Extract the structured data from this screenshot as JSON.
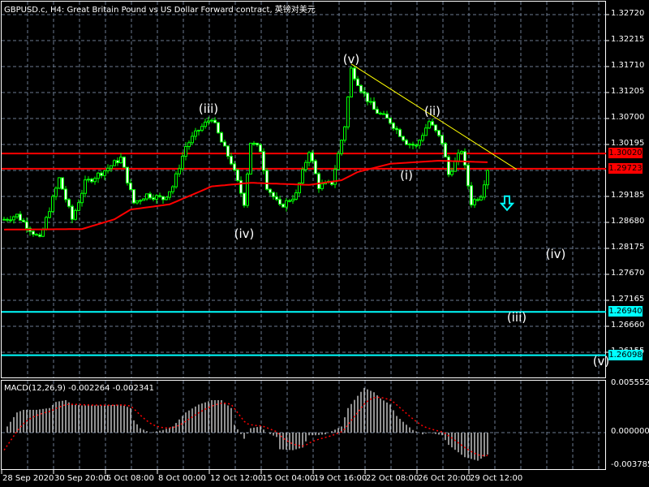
{
  "title": "GBPUSD.c, H4:  Great Britain Pound vs US Dollar Forward contract, 英镑对美元",
  "macd_label": "MACD(12,26,9) -0.002264 -0.002341",
  "colors": {
    "bg": "#000000",
    "grid": "#6b7a8f",
    "candle": "#00ff00",
    "ma": "#ff0000",
    "resistance": "#ff0000",
    "support": "#00ffff",
    "trend": "#ffff00",
    "hist": "#c0c0c0",
    "signal": "#ff0000"
  },
  "price_axis": {
    "min": 1.2584,
    "max": 1.33,
    "ticks": [
      "1.32720",
      "1.32215",
      "1.31710",
      "1.31205",
      "1.30700",
      "1.30195",
      "1.29185",
      "1.28680",
      "1.28175",
      "1.27670",
      "1.27165",
      "1.26660",
      "1.26155"
    ],
    "tags": [
      {
        "value": "1.30020",
        "price": 1.3002,
        "color": "#ff0000",
        "text_color": "#000000"
      },
      {
        "value": "1.29723",
        "price": 1.29723,
        "color": "#ff0000",
        "text_color": "#000000"
      },
      {
        "value": "1.26940",
        "price": 1.2694,
        "color": "#00ffff",
        "text_color": "#000000"
      },
      {
        "value": "1.26098",
        "price": 1.26098,
        "color": "#00ffff",
        "text_color": "#000000"
      }
    ]
  },
  "macd_axis": {
    "ticks": [
      "0.005552",
      "0.000000",
      "-0.003785"
    ],
    "max": 0.005552,
    "min": -0.003785
  },
  "time_axis": [
    "28 Sep 2020",
    "30 Sep 20:00",
    "5 Oct 08:00",
    "8 Oct 00:00",
    "12 Oct 12:00",
    "15 Oct 04:00",
    "19 Oct 16:00",
    "22 Oct 08:00",
    "26 Oct 20:00",
    "29 Oct 12:00"
  ],
  "wave_labels": [
    {
      "text": "(v)",
      "bar": 107,
      "price": 1.3184
    },
    {
      "text": "(iii)",
      "bar": 63,
      "price": 1.3088
    },
    {
      "text": "(iv)",
      "bar": 74,
      "price": 1.2845
    },
    {
      "text": "(ii)",
      "bar": 132,
      "price": 1.3082
    },
    {
      "text": "(i)",
      "bar": 124,
      "price": 1.2958
    },
    {
      "text": "(iv)",
      "bar": 170,
      "price": 1.2805
    },
    {
      "text": "(iii)",
      "bar": 158,
      "price": 1.2681
    },
    {
      "text": "(v)",
      "bar": 184,
      "price": 1.2597
    }
  ],
  "signal_arrow": {
    "icon": "down-arrow",
    "bar": 155,
    "price": 1.29
  },
  "trendline": {
    "from": {
      "bar": 107,
      "price": 1.3176
    },
    "to": {
      "bar": 158,
      "price": 1.2971
    }
  },
  "price_keys": [
    [
      0,
      1.2874
    ],
    [
      4,
      1.2882
    ],
    [
      11,
      1.2835
    ],
    [
      17,
      1.2953
    ],
    [
      21,
      1.2874
    ],
    [
      25,
      1.2945
    ],
    [
      31,
      1.2969
    ],
    [
      36,
      1.2993
    ],
    [
      40,
      1.2906
    ],
    [
      44,
      1.2922
    ],
    [
      49,
      1.2914
    ],
    [
      52,
      1.2938
    ],
    [
      56,
      1.3016
    ],
    [
      60,
      1.3048
    ],
    [
      64,
      1.3072
    ],
    [
      67,
      1.3024
    ],
    [
      70,
      1.2985
    ],
    [
      74,
      1.2906
    ],
    [
      76,
      1.3024
    ],
    [
      79,
      1.3009
    ],
    [
      81,
      1.2938
    ],
    [
      85,
      1.2898
    ],
    [
      90,
      1.2922
    ],
    [
      94,
      1.3008
    ],
    [
      97,
      1.2938
    ],
    [
      101,
      1.2945
    ],
    [
      105,
      1.3056
    ],
    [
      107,
      1.3166
    ],
    [
      110,
      1.3127
    ],
    [
      114,
      1.3087
    ],
    [
      119,
      1.3064
    ],
    [
      124,
      1.3024
    ],
    [
      127,
      1.3016
    ],
    [
      131,
      1.3064
    ],
    [
      135,
      1.3024
    ],
    [
      137,
      1.2961
    ],
    [
      141,
      1.3009
    ],
    [
      144,
      1.2906
    ],
    [
      147,
      1.2922
    ],
    [
      149,
      1.2972
    ]
  ],
  "ma_keys": [
    [
      0,
      1.2854
    ],
    [
      24,
      1.2855
    ],
    [
      34,
      1.2874
    ],
    [
      39,
      1.2893
    ],
    [
      51,
      1.2903
    ],
    [
      64,
      1.2938
    ],
    [
      76,
      1.2945
    ],
    [
      94,
      1.2941
    ],
    [
      104,
      1.295
    ],
    [
      109,
      1.2966
    ],
    [
      119,
      1.2982
    ],
    [
      134,
      1.2988
    ],
    [
      149,
      1.2985
    ]
  ],
  "macd_keys": [
    [
      0,
      0
    ],
    [
      1,
      0.0007
    ],
    [
      4,
      0.0023
    ],
    [
      6,
      0.0026
    ],
    [
      10,
      0.0026
    ],
    [
      14,
      0.0028
    ],
    [
      16,
      0.0035
    ],
    [
      19,
      0.0037
    ],
    [
      21,
      0.0032
    ],
    [
      24,
      0.0031
    ],
    [
      31,
      0.0031
    ],
    [
      36,
      0.0032
    ],
    [
      39,
      0.0028
    ],
    [
      40,
      0.0014
    ],
    [
      42,
      0.0005
    ],
    [
      45,
      0
    ],
    [
      49,
      0.0003
    ],
    [
      52,
      0.0007
    ],
    [
      56,
      0.0023
    ],
    [
      60,
      0.0032
    ],
    [
      64,
      0.0037
    ],
    [
      67,
      0.0037
    ],
    [
      70,
      0.0028
    ],
    [
      71,
      0.0009
    ],
    [
      74,
      -0.0007
    ],
    [
      76,
      0.0005
    ],
    [
      79,
      0.0007
    ],
    [
      81,
      0
    ],
    [
      84,
      -0.0005
    ],
    [
      85,
      -0.0019
    ],
    [
      89,
      -0.002
    ],
    [
      92,
      -0.0017
    ],
    [
      94,
      -0.0003
    ],
    [
      96,
      -0.0003
    ],
    [
      99,
      -0.0002
    ],
    [
      104,
      0.0007
    ],
    [
      106,
      0.0028
    ],
    [
      109,
      0.0042
    ],
    [
      111,
      0.0051
    ],
    [
      114,
      0.0046
    ],
    [
      116,
      0.0039
    ],
    [
      119,
      0.0032
    ],
    [
      121,
      0.0019
    ],
    [
      124,
      0.0009
    ],
    [
      126,
      0.0003
    ],
    [
      129,
      -0.0002
    ],
    [
      131,
      0
    ],
    [
      135,
      -0.0003
    ],
    [
      137,
      -0.0014
    ],
    [
      142,
      -0.0028
    ],
    [
      146,
      -0.0032
    ],
    [
      149,
      -0.0025
    ]
  ]
}
